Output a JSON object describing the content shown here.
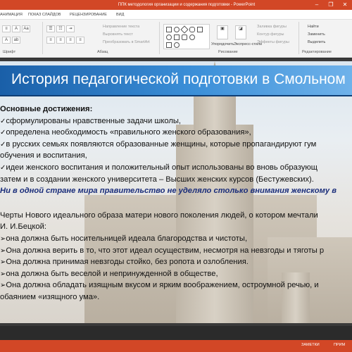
{
  "window": {
    "title": "ППК методология организации и содержания подготовки - PowerPoint",
    "minimize": "–",
    "restore": "❐",
    "close": "✕"
  },
  "ribbon_tabs": [
    "АНИМАЦИЯ",
    "ПОКАЗ СЛАЙДОВ",
    "РЕЦЕНЗИРОВАНИЕ",
    "ВИД"
  ],
  "ribbon": {
    "font_group": "Шрифт",
    "paragraph_group": "Абзац",
    "drawing_group": "Рисование",
    "editing_group": "Редактирование",
    "text_direction": "Направление текста",
    "align_text": "Выровнять текст",
    "smartart": "Преобразовать в SmartArt",
    "arrange": "Упорядочить",
    "quick_styles": "Экспресс-стили",
    "shape_fill": "Заливка фигуры",
    "shape_outline": "Контур фигуры",
    "shape_effects": "Эффекты фигуры",
    "find": "Найти",
    "replace": "Заменить",
    "select": "Выделить"
  },
  "slide": {
    "title": "История педагогической подготовки в Смольном",
    "achievements_heading": "Основные достижения:",
    "achievements": [
      "сформулированы нравственные задачи школы,",
      "определена необходимость «правильного женского образования»,",
      "в русских семьях появляются образованные женщины, которые пропагандируют гум"
    ],
    "achievements_cont": "обучения и воспитания,",
    "ideas_line": "идеи женского воспитания и положительный опыт использованы во вновь образующ",
    "ideas_cont": "затем и в создании женского университета – Высших женских курсов (Бестужевских).",
    "emphasis": "Ни в одной стране мира правительство не уделяло столько внимания женскому в",
    "traits_intro": "Черты Нового идеального образа матери нового поколения людей, о котором мечтали",
    "traits_author": "И. И.Бецкой:",
    "traits": [
      "она должна быть носительницей идеала благородства и чистоты,",
      "Она должна верить в то, что этот идеал осуществим, несмотря на невзгоды и тяготы р",
      "Она должна принимая невзгоды стойко, без ропота и озлобления.",
      "она должна быть веселой и непринужденной в обществе,",
      "Она должна обладать изящным вкусом и ярким воображением, остроумной речью, и"
    ],
    "traits_last_cont": "обаянием «изящного ума»."
  },
  "status": {
    "notes": "ЗАМЕТКИ",
    "comments": "ПРИМ"
  },
  "colors": {
    "accent": "#d24726",
    "title_band": "#2f7fcf",
    "emphasis_text": "#1a2d7a"
  }
}
